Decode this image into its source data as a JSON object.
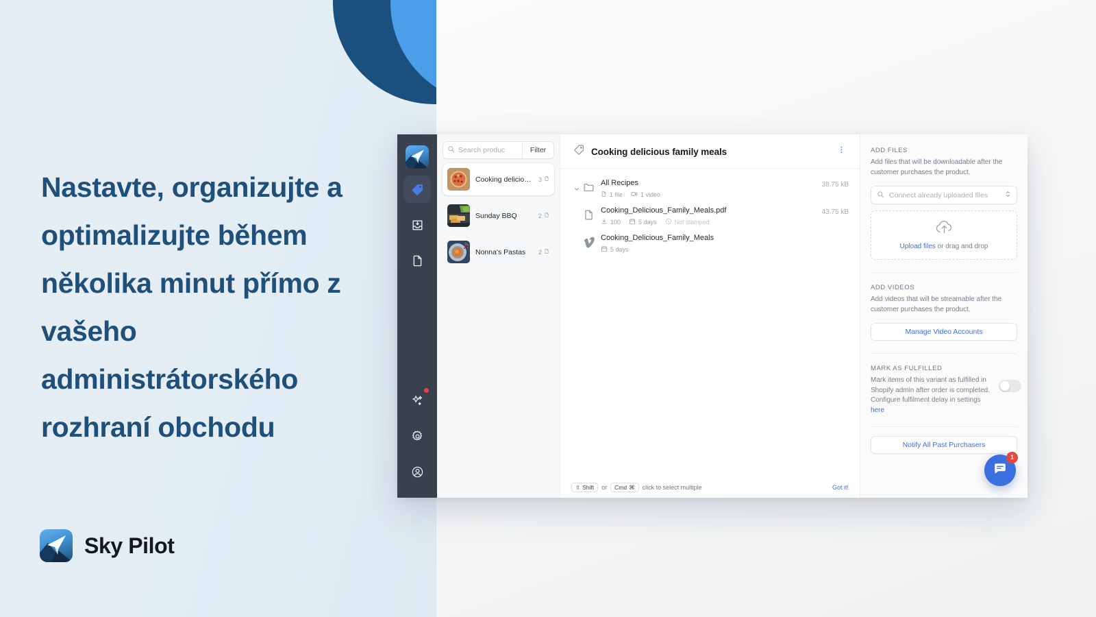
{
  "marketing": {
    "headline": "Nastavte, organizujte a optimalizujte během několika minut přímo z vašeho administrátorského rozhraní obchodu",
    "brand_name": "Sky Pilot",
    "colors": {
      "headline": "#20507a",
      "circle_dark": "#1b4f7d",
      "circle_light": "#4a9fe8",
      "panel_bg": "#e6eef4"
    }
  },
  "app": {
    "sidebar": {
      "items": [
        {
          "name": "logo",
          "icon": "sky-pilot-logo-icon",
          "active": false
        },
        {
          "name": "products",
          "icon": "tag-icon",
          "active": true
        },
        {
          "name": "downloads",
          "icon": "inbox-download-icon",
          "active": false
        },
        {
          "name": "pages",
          "icon": "file-icon",
          "active": false
        },
        {
          "name": "whats-new",
          "icon": "sparkles-icon",
          "active": false,
          "badge": true
        },
        {
          "name": "settings",
          "icon": "gear-icon",
          "active": false
        },
        {
          "name": "account",
          "icon": "user-circle-icon",
          "active": false
        }
      ]
    },
    "product_list": {
      "search_placeholder": "Search produc",
      "search_value": "",
      "filter_label": "Filter",
      "items": [
        {
          "name": "Cooking delicious f...",
          "count": "3",
          "selected": true,
          "thumb": "pizza-thumbnail"
        },
        {
          "name": "Sunday BBQ",
          "count": "2",
          "selected": false,
          "thumb": "bbq-thumbnail"
        },
        {
          "name": "Nonna's Pastas",
          "count": "2",
          "selected": false,
          "thumb": "pasta-thumbnail"
        }
      ]
    },
    "main": {
      "title": "Cooking delicious family meals",
      "rows": [
        {
          "name": "All Recipes",
          "icon": "folder-icon",
          "expandable": true,
          "size": "38.75 kB",
          "meta": [
            {
              "icon": "file-icon",
              "text": "1 file",
              "dim": false
            },
            {
              "icon": "video-icon",
              "text": "1 video",
              "dim": false
            }
          ]
        },
        {
          "name": "Cooking_Delicious_Family_Meals.pdf",
          "icon": "file-icon",
          "expandable": false,
          "size": "43.75 kB",
          "meta": [
            {
              "icon": "download-icon",
              "text": "100",
              "dim": false
            },
            {
              "icon": "calendar-icon",
              "text": "5 days",
              "dim": false
            },
            {
              "icon": "stamp-icon",
              "text": "Not stamped",
              "dim": true
            }
          ]
        },
        {
          "name": "Cooking_Delicious_Family_Meals",
          "icon": "vimeo-icon",
          "expandable": false,
          "size": "",
          "meta": [
            {
              "icon": "calendar-icon",
              "text": "5 days",
              "dim": false
            }
          ]
        }
      ],
      "hint": {
        "key1": "Shift",
        "key1_symbol": "⇧",
        "joiner": "or",
        "key2": "Cmd",
        "key2_symbol": "⌘",
        "text": "click to select multiple",
        "dismiss": "Got it!"
      }
    },
    "inspector": {
      "add_files": {
        "title": "ADD FILES",
        "description": "Add files that will be downloadable after the customer purchases the product.",
        "connect_placeholder": "Connect already uploaded files",
        "upload_link": "Upload files",
        "upload_rest": " or drag and drop"
      },
      "add_videos": {
        "title": "ADD VIDEOS",
        "description": "Add videos that will be streamable after the customer purchases the product.",
        "button_label": "Manage Video Accounts"
      },
      "mark_fulfilled": {
        "title": "MARK AS FULFILLED",
        "description_part1": "Mark items of this variant as fulfilled in Shopify admin after order is completed. Configure fulfilment delay in settings ",
        "description_link": "here",
        "toggle_on": false
      },
      "notify_button": "Notify All Past Purchasers"
    },
    "chat": {
      "badge_count": "1",
      "icon": "chat-bubble-icon",
      "color": "#3b6fe0"
    }
  }
}
